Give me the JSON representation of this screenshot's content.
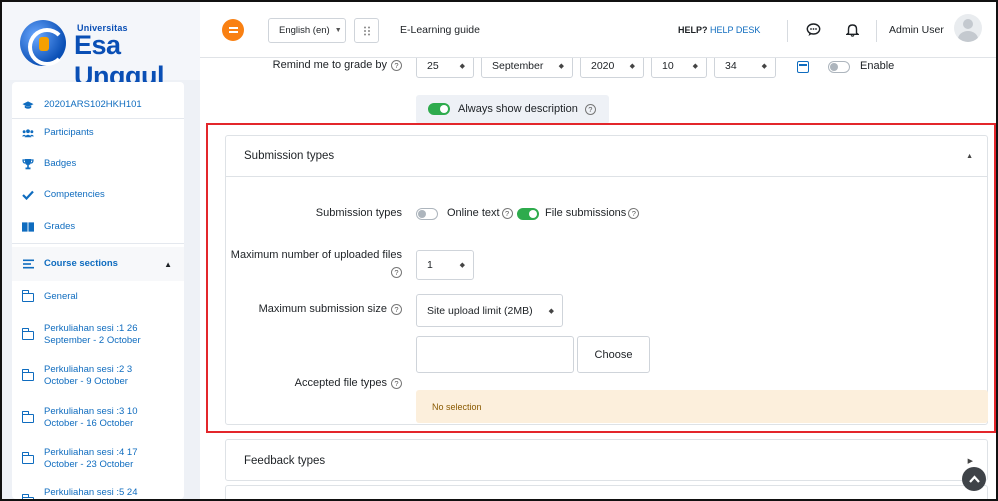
{
  "brand": {
    "small": "Universitas",
    "name": "Esa Unggul"
  },
  "navbar": {
    "language": "English (en)",
    "guide": "E-Learning guide",
    "help_bold": "HELP?",
    "help_link": "HELP DESK",
    "user": "Admin User",
    "accent": "#f98012"
  },
  "sidebar": {
    "items": [
      {
        "label": "20201ARS102HKH101",
        "icon": "graduation-cap-icon"
      },
      {
        "label": "Participants",
        "icon": "users-icon"
      },
      {
        "label": "Badges",
        "icon": "trophy-icon"
      },
      {
        "label": "Competencies",
        "icon": "checkmark-icon"
      },
      {
        "label": "Grades",
        "icon": "table-icon"
      }
    ],
    "course_sections": "Course sections",
    "sections": [
      {
        "label": "General"
      },
      {
        "line1": "Perkuliahan sesi :1 26",
        "line2": "September - 2 October"
      },
      {
        "line1": "Perkuliahan sesi :2 3",
        "line2": "October - 9 October"
      },
      {
        "line1": "Perkuliahan sesi :3 10",
        "line2": "October - 16 October"
      },
      {
        "line1": "Perkuliahan sesi :4 17",
        "line2": "October - 23 October"
      },
      {
        "line1": "Perkuliahan sesi :5 24",
        "line2": ""
      }
    ]
  },
  "remind": {
    "label": "Remind me to grade by",
    "day": "25",
    "month": "September",
    "year": "2020",
    "hour": "10",
    "minute": "34",
    "enable": "Enable"
  },
  "always_show": "Always show description",
  "submission": {
    "header": "Submission types",
    "types_label": "Submission types",
    "online_text": "Online text",
    "file_submissions": "File submissions",
    "max_files_label_1": "Maximum number of uploaded files",
    "max_files_value": "1",
    "max_size_label": "Maximum submission size",
    "max_size_value": "Site upload limit (2MB)",
    "accepted_label": "Accepted file types",
    "choose": "Choose",
    "no_selection": "No selection"
  },
  "feedback": {
    "header": "Feedback types"
  }
}
